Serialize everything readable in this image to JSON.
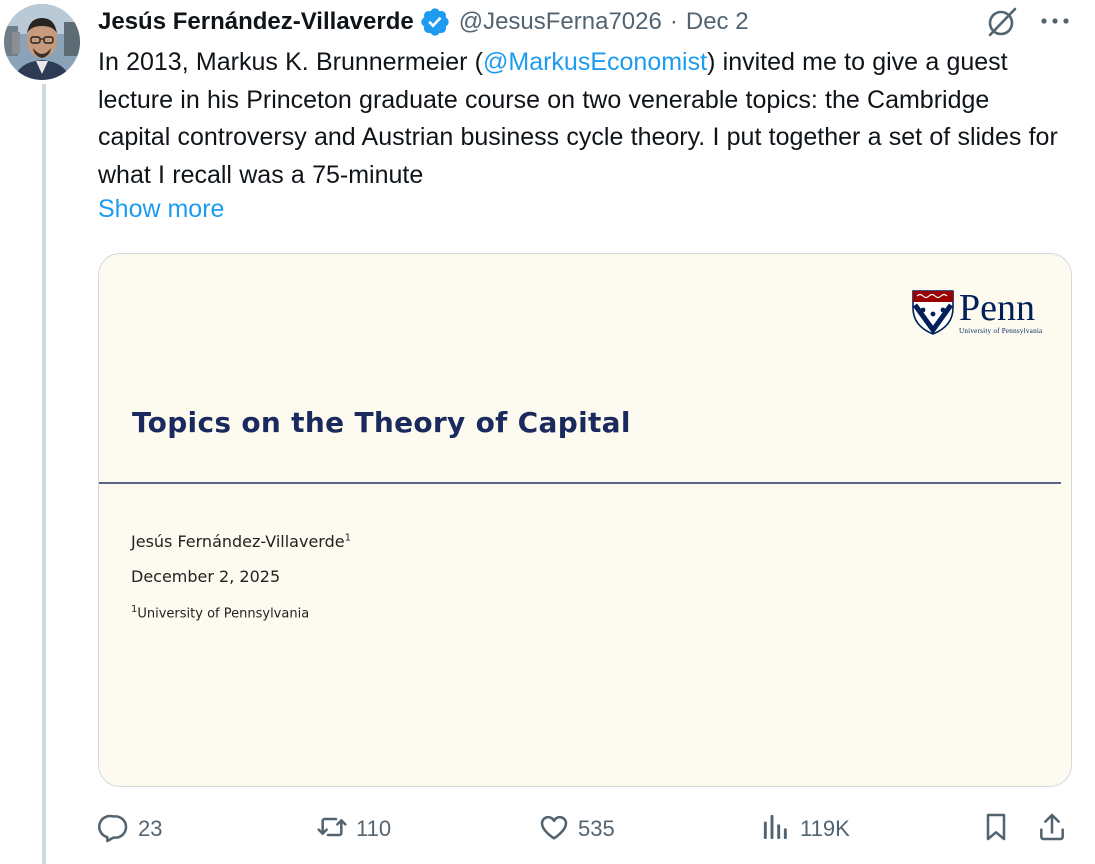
{
  "author": {
    "display_name": "Jesús Fernández-Villaverde",
    "handle": "@JesusFerna7026",
    "separator": "·",
    "date": "Dec 2",
    "verified": true
  },
  "tweet": {
    "text_before_mention": "In 2013, Markus K. Brunnermeier (",
    "mention": "@MarkusEconomist",
    "text_after_mention": ") invited me to give a guest lecture in his Princeton graduate course on two venerable topics: the Cambridge capital controversy and Austrian business cycle theory. I put together a set of slides for what I recall was a 75-minute",
    "show_more": "Show more"
  },
  "media": {
    "logo_word": "Penn",
    "logo_subtitle": "University of Pennsylvania",
    "slide_title": "Topics on the Theory of Capital",
    "slide_author": "Jesús Fernández-Villaverde",
    "slide_author_sup": "1",
    "slide_date": "December 2, 2025",
    "slide_affil_sup": "1",
    "slide_affiliation": "University of Pennsylvania"
  },
  "actions": {
    "replies": "23",
    "reposts": "110",
    "likes": "535",
    "views": "119K"
  },
  "icons": {
    "reply": "reply-icon",
    "repost": "repost-icon",
    "like": "heart-icon",
    "views": "views-icon",
    "bookmark": "bookmark-icon",
    "share": "share-icon",
    "grok": "grok-icon",
    "more": "more-icon",
    "verified": "verified-badge-icon"
  },
  "colors": {
    "accent": "#1d9bf0",
    "muted": "#536471",
    "text": "#0f1419",
    "slide_bg": "#fdfbf0",
    "slide_title": "#1a2a5e",
    "penn_blue": "#011f5b",
    "penn_red": "#990000"
  }
}
